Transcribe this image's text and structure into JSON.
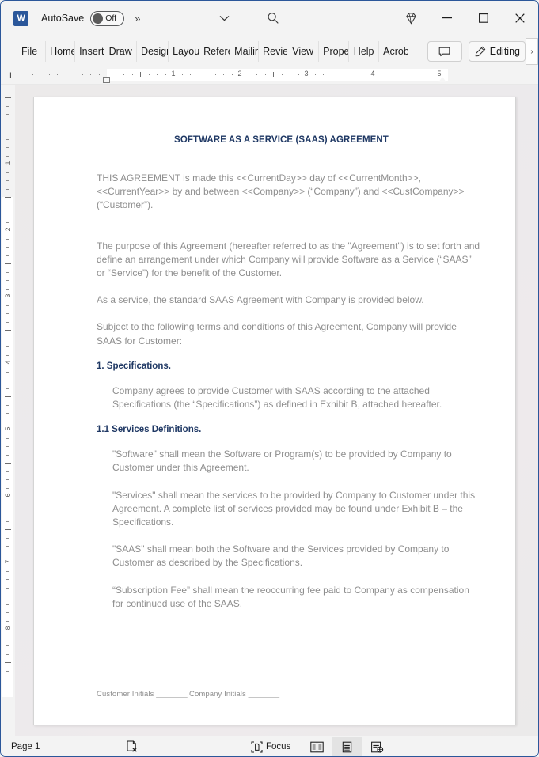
{
  "titlebar": {
    "app_icon": "word-icon",
    "autosave_label": "AutoSave",
    "autosave_state": "Off",
    "more_commands": "»",
    "caret_icon": "chevron-down-icon",
    "search_icon": "search-icon",
    "premium_icon": "diamond-icon",
    "minimize_label": "–",
    "maximize_label": "□",
    "close_label": "✕"
  },
  "ribbon": {
    "tabs": [
      {
        "label": "File",
        "key": "file"
      },
      {
        "label": "Home",
        "key": "home"
      },
      {
        "label": "Insert",
        "key": "insert"
      },
      {
        "label": "Draw",
        "key": "draw"
      },
      {
        "label": "Design",
        "key": "design"
      },
      {
        "label": "Layout",
        "key": "layout"
      },
      {
        "label": "References",
        "key": "references"
      },
      {
        "label": "Mailings",
        "key": "mailings"
      },
      {
        "label": "Review",
        "key": "review"
      },
      {
        "label": "View",
        "key": "view"
      },
      {
        "label": "Properties",
        "key": "properties"
      },
      {
        "label": "Help",
        "key": "help"
      },
      {
        "label": "Acrobat",
        "key": "acrobat"
      }
    ],
    "comments_icon": "comment-icon",
    "editing_label": "Editing",
    "editing_icon": "pencil-icon",
    "overflow_label": "›"
  },
  "ruler": {
    "tab_stop_marker": "L",
    "horizontal_numbers": [
      "1",
      "2",
      "3",
      "4",
      "5"
    ],
    "vertical_numbers": [
      "1",
      "2",
      "3",
      "4",
      "5",
      "6",
      "7",
      "8"
    ]
  },
  "document": {
    "title": "SOFTWARE AS A SERVICE (SAAS) AGREEMENT",
    "paragraphs": [
      "THIS AGREEMENT is made this <<CurrentDay>> day of <<CurrentMonth>>, <<CurrentYear>> by and between <<Company>> (“Company”) and <<CustCompany>> (“Customer”).",
      "The purpose of this Agreement (hereafter referred to as the \"Agreement\") is to set forth and define an arrangement under which Company will provide Software as a Service (“SAAS” or “Service”) for the benefit of the Customer.",
      "As a service, the standard SAAS Agreement with Company is provided below.",
      "Subject to the following terms and conditions of this Agreement, Company will provide SAAS for Customer:"
    ],
    "section_1_heading": "1. Specifications.",
    "section_1_body": "Company agrees to provide Customer with SAAS according to the attached Specifications (the “Specifications”) as defined in Exhibit B, attached hereafter.",
    "section_11_heading": "1.1 Services Definitions.",
    "definitions": [
      "\"Software\" shall mean the Software or Program(s) to be provided by Company to Customer under this Agreement.",
      "\"Services\" shall mean the services to be provided by Company to Customer under this Agreement. A complete list of services provided may be found under Exhibit B – the Specifications.",
      "\"SAAS\" shall mean both the Software and the Services provided by Company to Customer as described by the Specifications.",
      "“Subscription Fee” shall mean the reoccurring fee paid to Company as compensation for continued use of the SAAS."
    ],
    "footer": {
      "customer_initials_label": "Customer Initials",
      "customer_initials_rule": "________",
      "company_initials_label": "Company Initials",
      "company_initials_rule": "________"
    }
  },
  "statusbar": {
    "page_label": "Page 1",
    "proofing_icon": "proofing-errors-icon",
    "focus_label": "Focus",
    "focus_icon": "focus-icon",
    "views": [
      {
        "name": "read-mode",
        "icon": "read-mode-icon",
        "active": false
      },
      {
        "name": "print-layout",
        "icon": "print-layout-icon",
        "active": true
      },
      {
        "name": "web-layout",
        "icon": "web-layout-icon",
        "active": false
      }
    ]
  },
  "colors": {
    "brand": "#2b579a",
    "heading": "#1f3864",
    "body_text": "#8e8e8e",
    "chrome": "#f3f3f3"
  }
}
